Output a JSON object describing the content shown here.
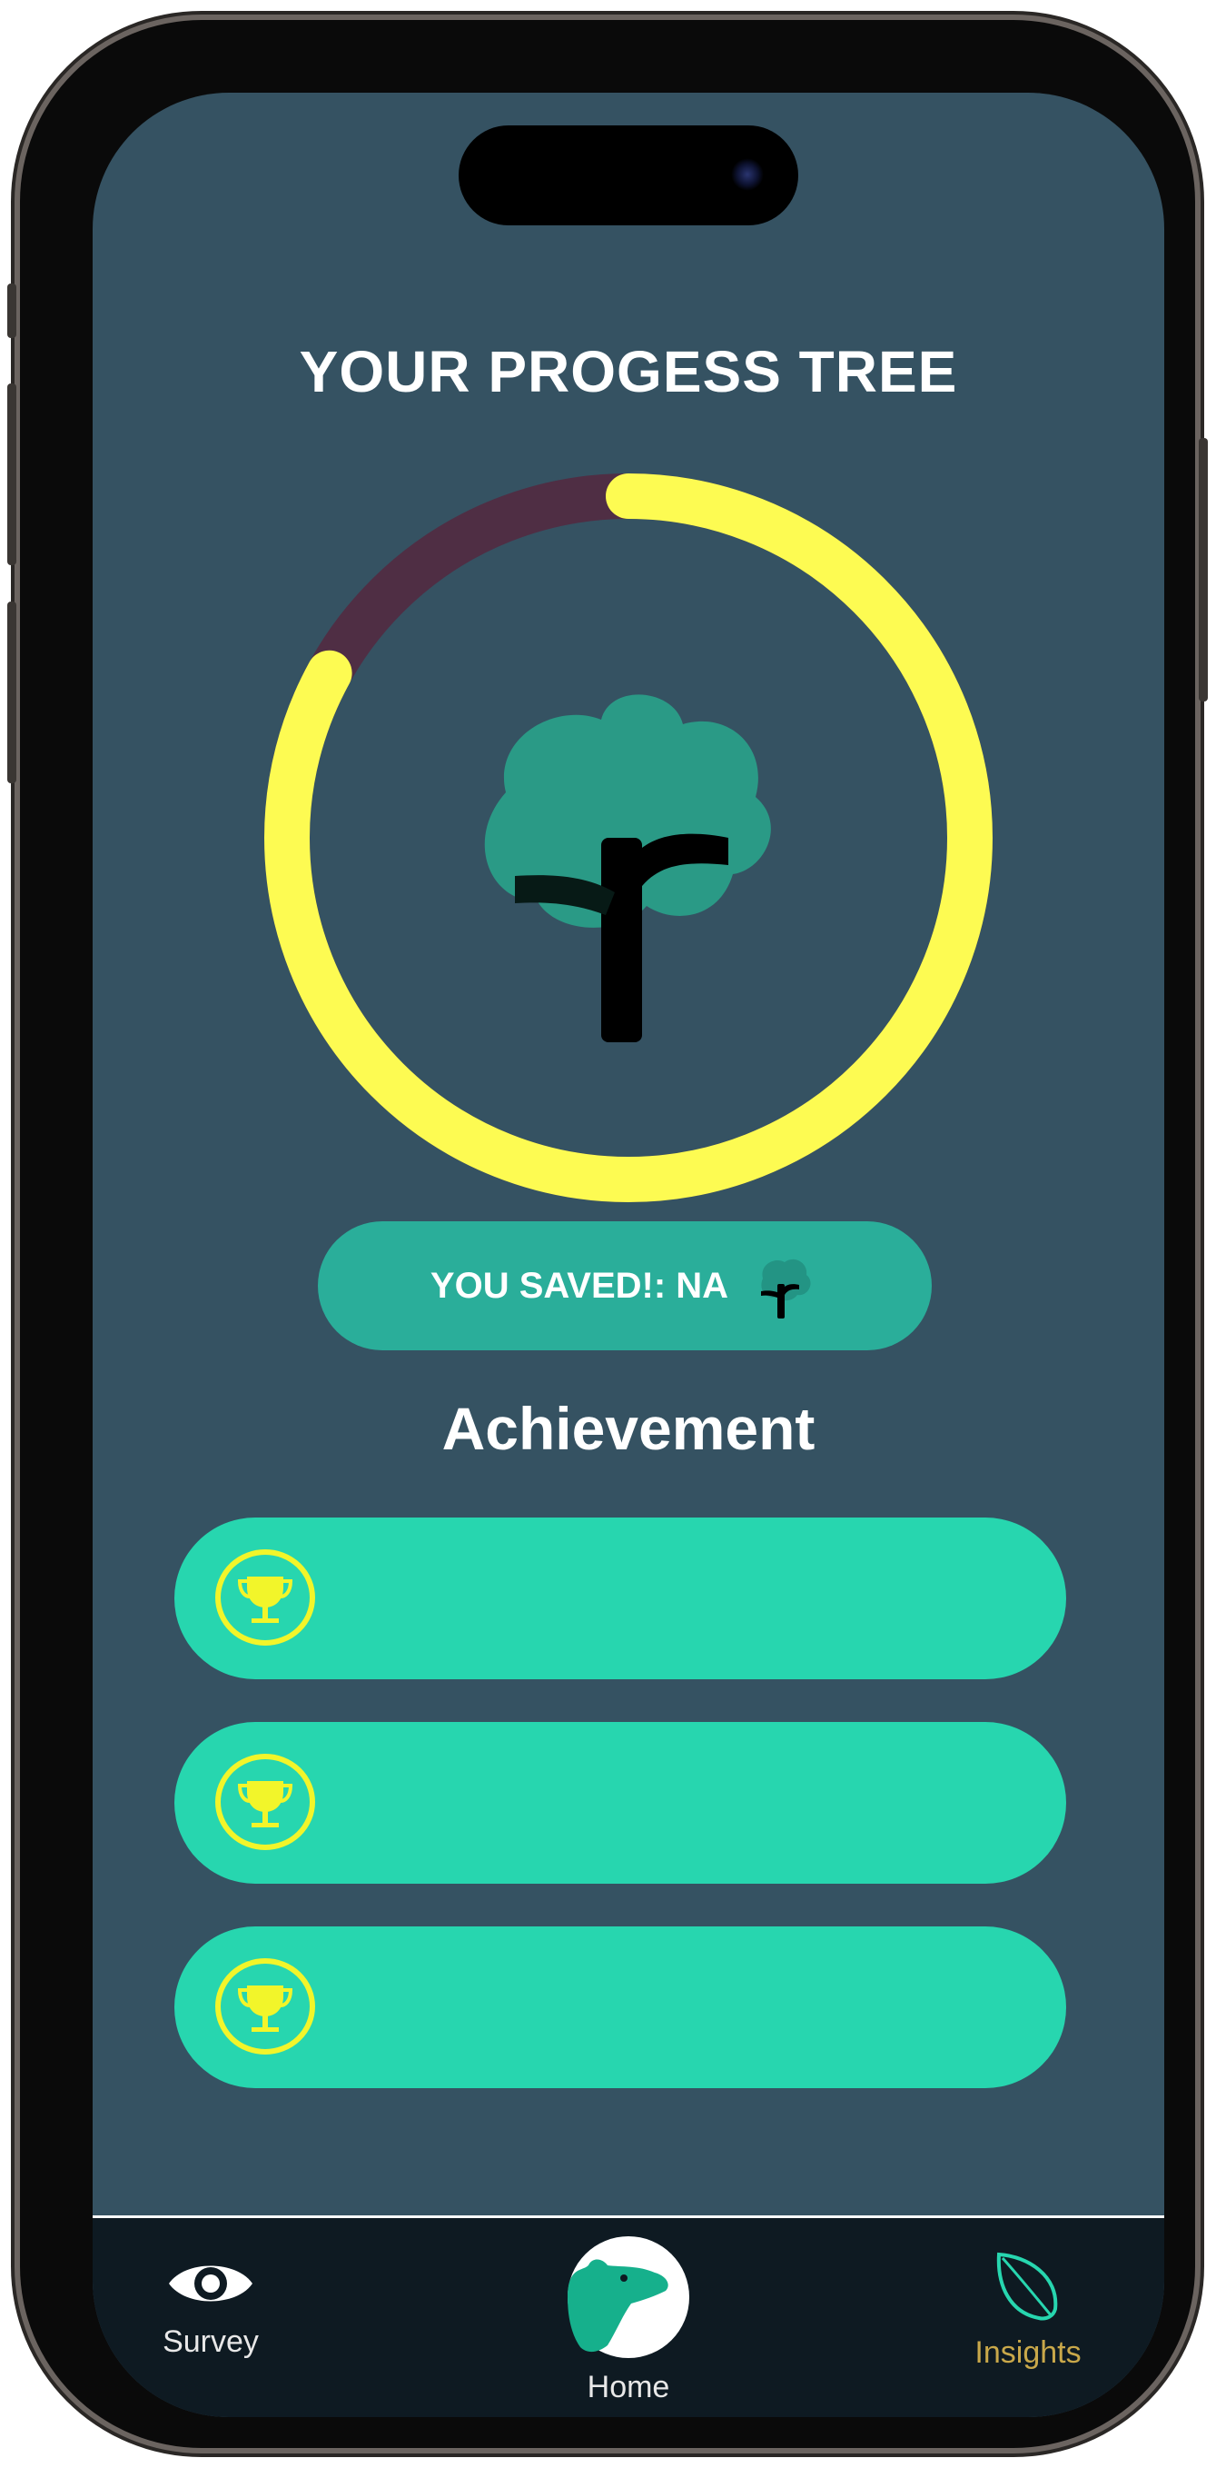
{
  "screen": {
    "title": "YOUR PROGESS TREE"
  },
  "progress": {
    "value": 0.83,
    "track_color": "#4f2e44",
    "fill_color": "#fdfb52",
    "icon": "tree-icon"
  },
  "saved": {
    "label": "YOU SAVED!: NA",
    "icon": "tree-icon"
  },
  "achievements": {
    "title": "Achievement",
    "items": [
      {
        "icon": "trophy-icon",
        "label": ""
      },
      {
        "icon": "trophy-icon",
        "label": ""
      },
      {
        "icon": "trophy-icon",
        "label": ""
      }
    ]
  },
  "tab_bar": {
    "items": [
      {
        "label": "Survey",
        "icon": "eye-icon",
        "color": "#e8e8e8"
      },
      {
        "label": "Home",
        "icon": "bear-icon",
        "color": "#e8e8e8"
      },
      {
        "label": "Insights",
        "icon": "leaf-icon",
        "color": "#c9a84a"
      }
    ]
  },
  "colors": {
    "background": "#355262",
    "accent": "#27d6af",
    "pill": "#2aae9a",
    "tree_canopy": "#2a9a86",
    "highlight": "#fdfb52"
  }
}
